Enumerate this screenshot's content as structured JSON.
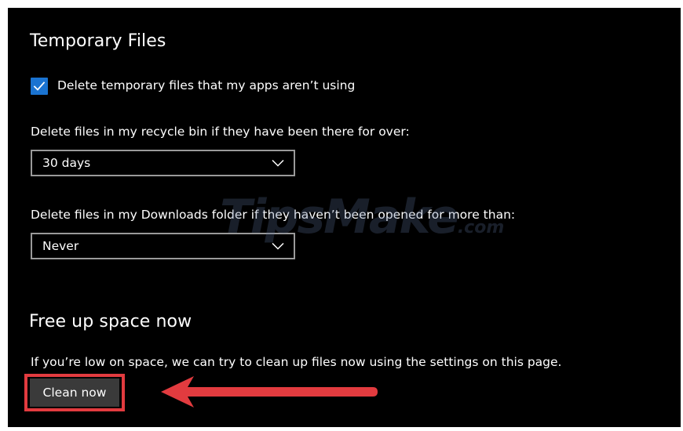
{
  "temporary_files": {
    "title": "Temporary Files",
    "delete_temp_label": "Delete temporary files that my apps aren’t using",
    "delete_temp_checked": true,
    "recycle_bin_label": "Delete files in my recycle bin if they have been there for over:",
    "recycle_bin_value": "30 days",
    "downloads_label": "Delete files in my Downloads folder if they haven’t been opened for more than:",
    "downloads_value": "Never"
  },
  "free_up_space": {
    "title": "Free up space now",
    "description": "If you’re low on space, we can try to clean up files now using the settings on this page.",
    "clean_button_label": "Clean now"
  },
  "annotation": {
    "highlight_color": "#e23b3f",
    "arrow_icon": "arrow-left-icon"
  },
  "watermark": {
    "text": "TipsMake",
    "suffix": ".com"
  },
  "colors": {
    "background": "#000000",
    "accent": "#1a73d1",
    "text": "#ffffff",
    "select_border": "#9a9a9a",
    "button_bg": "#3a3a3a"
  }
}
